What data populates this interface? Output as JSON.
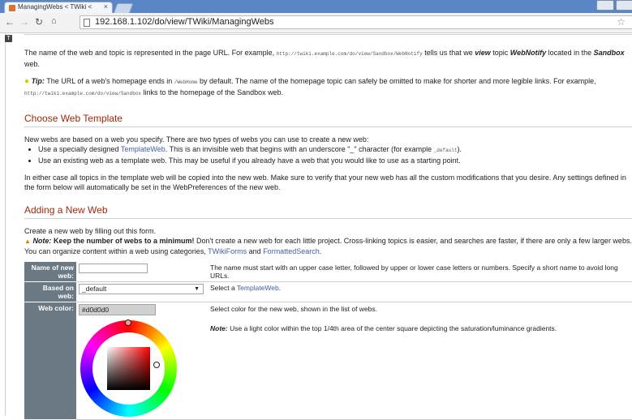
{
  "browser": {
    "tab_title": "ManagingWebs < TWiki <",
    "tab_close": "×",
    "url": "192.168.1.102/do/view/TWiki/ManagingWebs",
    "star": "☆"
  },
  "intro": {
    "p1_a": "The name of the web and topic is represented in the page URL. For example, ",
    "p1_url": "http://twiki.example.com/do/view/Sandbox/WebNotify",
    "p1_b": " tells us that we ",
    "p1_view": "view",
    "p1_c": " topic ",
    "p1_topic": "WebNotify",
    "p1_d": " located in the ",
    "p1_web": "Sandbox",
    "p1_e": "web.",
    "tip_label": "Tip:",
    "tip_a": " The URL of a web's homepage ends in ",
    "tip_code": "/WebHome",
    "tip_b": " by default. The name of the homepage topic can safely be omitted to make for shorter and more legible links. For example,",
    "tip_url": "http://twiki.example.com/do/view/Sandbox",
    "tip_c": " links to the homepage of the Sandbox web."
  },
  "choose": {
    "heading": "Choose Web Template",
    "p1": "New webs are based on a web you specify. There are two types of webs you can use to create a new web:",
    "li1_a": "Use a specially designed ",
    "li1_link": "TemplateWeb",
    "li1_b": ". This is an invisible web that begins with an underscore \"_\" character (for example ",
    "li1_code": "_default",
    "li1_c": ").",
    "li2": "Use an existing web as a template web. This may be useful if you already have a web that you would like to use as a starting point.",
    "p2": "In either case all topics in the template web will be copied into the new web. Make sure to verify that your new web has all the custom modifications that you desire. Any settings defined in the form below will automatically be set in the WebPreferences of the new web."
  },
  "adding": {
    "heading": "Adding a New Web",
    "p1": "Create a new web by filling out this form.",
    "note_label": "Note:",
    "note_bold": " Keep the number of webs to a minimum!",
    "note_rest": " Don't create a new web for each little project. Cross-linking topics is easier, and searches are faster, if there are only a few larger webs.",
    "p2_a": "You can organize content within a web using categories, ",
    "p2_link1": "TWikiForms",
    "p2_b": " and ",
    "p2_link2": "FormattedSearch",
    "p2_c": "."
  },
  "form": {
    "name_label": "Name of new web:",
    "name_value": "",
    "name_desc": "The name must start with an upper case letter, followed by upper or lower case letters or numbers. Specify a short name to avoid long URLs.",
    "based_label": "Based on web:",
    "based_value": "_default",
    "based_desc_a": "Select a ",
    "based_desc_link": "TemplateWeb",
    "based_desc_b": ".",
    "color_label": "Web color:",
    "color_value": "#d0d0d0",
    "color_desc": "Select color for the new web, shown in the list of webs.",
    "color_note_label": "Note:",
    "color_note": " Use a light color within the top 1/4th area of the center square depicting the saturation/luminance gradients."
  }
}
